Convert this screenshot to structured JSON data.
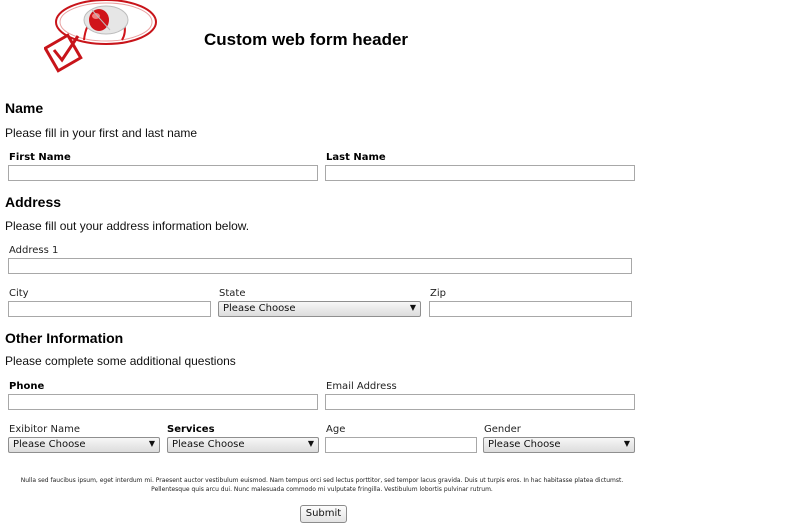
{
  "header": {
    "title": "Custom web form header",
    "logo_icon": "mouse-checkbox-logo-icon"
  },
  "sections": {
    "name": {
      "title": "Name",
      "description": "Please fill in your first and last name",
      "first_name_label": "First Name",
      "last_name_label": "Last Name",
      "first_name_value": "",
      "last_name_value": ""
    },
    "address": {
      "title": "Address",
      "description": "Please fill out your address information below.",
      "address1_label": "Address 1",
      "city_label": "City",
      "state_label": "State",
      "state_selected": "Please Choose",
      "zip_label": "Zip"
    },
    "other": {
      "title": "Other Information",
      "description": "Please complete some additional questions",
      "phone_label": "Phone",
      "email_label": "Email Address",
      "exhibitor_label": "Exibitor Name",
      "exhibitor_selected": "Please Choose",
      "services_label": "Services",
      "services_selected": "Please Choose",
      "age_label": "Age",
      "gender_label": "Gender",
      "gender_selected": "Please Choose"
    }
  },
  "footer": {
    "fine_print": "Nulla sed faucibus ipsum, eget interdum mi. Praesent auctor vestibulum euismod. Nam tempus orci sed lectus porttitor, sed tempor lacus gravida. Duis ut turpis eros. In hac habitasse platea dictumst. Pellentesque quis arcu dui. Nunc malesuada commodo mi vulputate fringilla. Vestibulum lobortis pulvinar rutrum.",
    "submit_label": "Submit"
  },
  "colors": {
    "logo_red": "#d0141a",
    "input_border": "#a8a8a8"
  }
}
